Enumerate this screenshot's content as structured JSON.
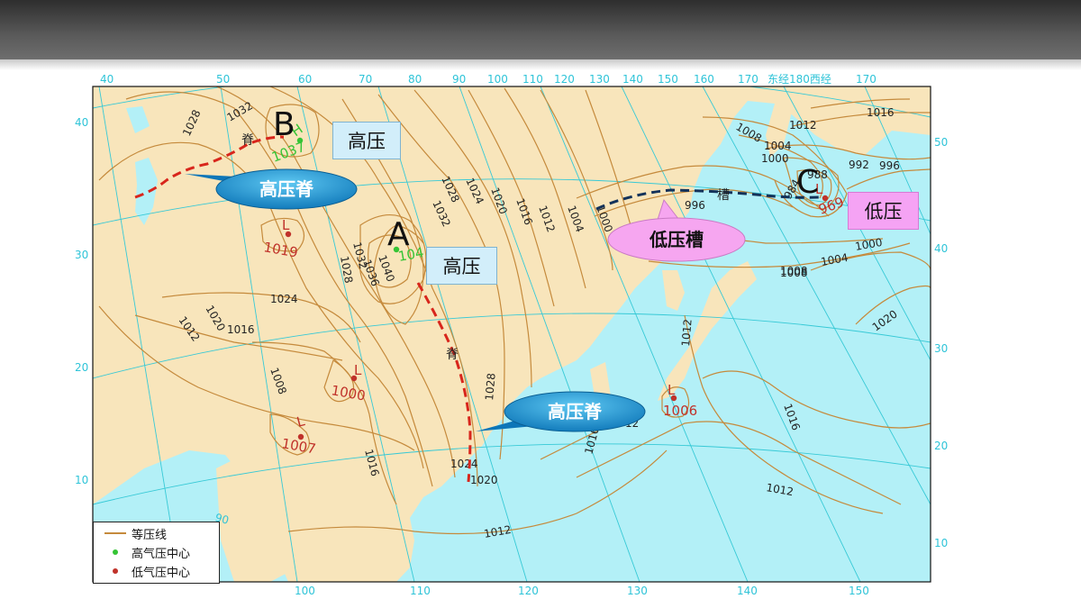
{
  "lon_top": [
    "40",
    "50",
    "60",
    "70",
    "80",
    "90",
    "100",
    "110",
    "120",
    "130",
    "140",
    "150",
    "160",
    "170",
    "东经180西经",
    "170"
  ],
  "lon_bottom": [
    "100",
    "110",
    "120",
    "130",
    "140",
    "150"
  ],
  "lat_left": [
    "40",
    "30",
    "20",
    "10"
  ],
  "lat_right": [
    "50",
    "40",
    "30",
    "20",
    "10"
  ],
  "lat_inner_90": "90",
  "isobar_labels": [
    "1028",
    "1032",
    "1024",
    "1020",
    "1016",
    "1012",
    "1008",
    "1004",
    "1000",
    "1008",
    "1012",
    "1016",
    "1004",
    "1000",
    "992",
    "996",
    "984",
    "988",
    "996",
    "1000",
    "1004",
    "1008",
    "1020",
    "1012",
    "1016",
    "1012",
    "1024",
    "1020",
    "1016",
    "1028",
    "1032",
    "1036",
    "1040",
    "1028",
    "1032",
    "1028",
    "1024",
    "1020",
    "1016",
    "1012",
    "1008",
    "1016",
    "1012",
    "1012",
    "1028",
    "1012",
    "1016",
    "1024",
    "1020",
    "12"
  ],
  "centers": {
    "high_B": {
      "symbol": "H",
      "value": "1037"
    },
    "high_A": {
      "symbol": "",
      "value": "104"
    },
    "low_1019": {
      "symbol": "L",
      "value": "1019"
    },
    "low_1000": {
      "symbol": "L",
      "value": "1000"
    },
    "low_1007": {
      "symbol": "L",
      "value": "1007"
    },
    "low_1006": {
      "symbol": "L",
      "value": "1006"
    },
    "low_C": {
      "symbol": "L",
      "value": "969"
    }
  },
  "letters": {
    "A": "A",
    "B": "B",
    "C": "C"
  },
  "ridge_char": "脊",
  "trough_char": "槽",
  "boxes": {
    "high_1": "高压",
    "high_2": "高压",
    "low": "低压"
  },
  "bubbles": {
    "ridge_1": "高压脊",
    "ridge_2": "高压脊",
    "trough": "低压槽"
  },
  "legend": {
    "isobar": "等压线",
    "high_center": "高气压中心",
    "low_center": "低气压中心"
  },
  "colors": {
    "land": "#f8e5bb",
    "sea": "#b3f0f7",
    "isobar": "#c58a3c",
    "grid": "#37c9d6",
    "high": "#35c435",
    "low": "#c0322a",
    "ridge_line": "#d8261c",
    "trough_line": "#13325a",
    "bubble_blue": "#1596d6",
    "bubble_pink": "#f6a6f0",
    "box_pink": "#f5a3f4"
  }
}
